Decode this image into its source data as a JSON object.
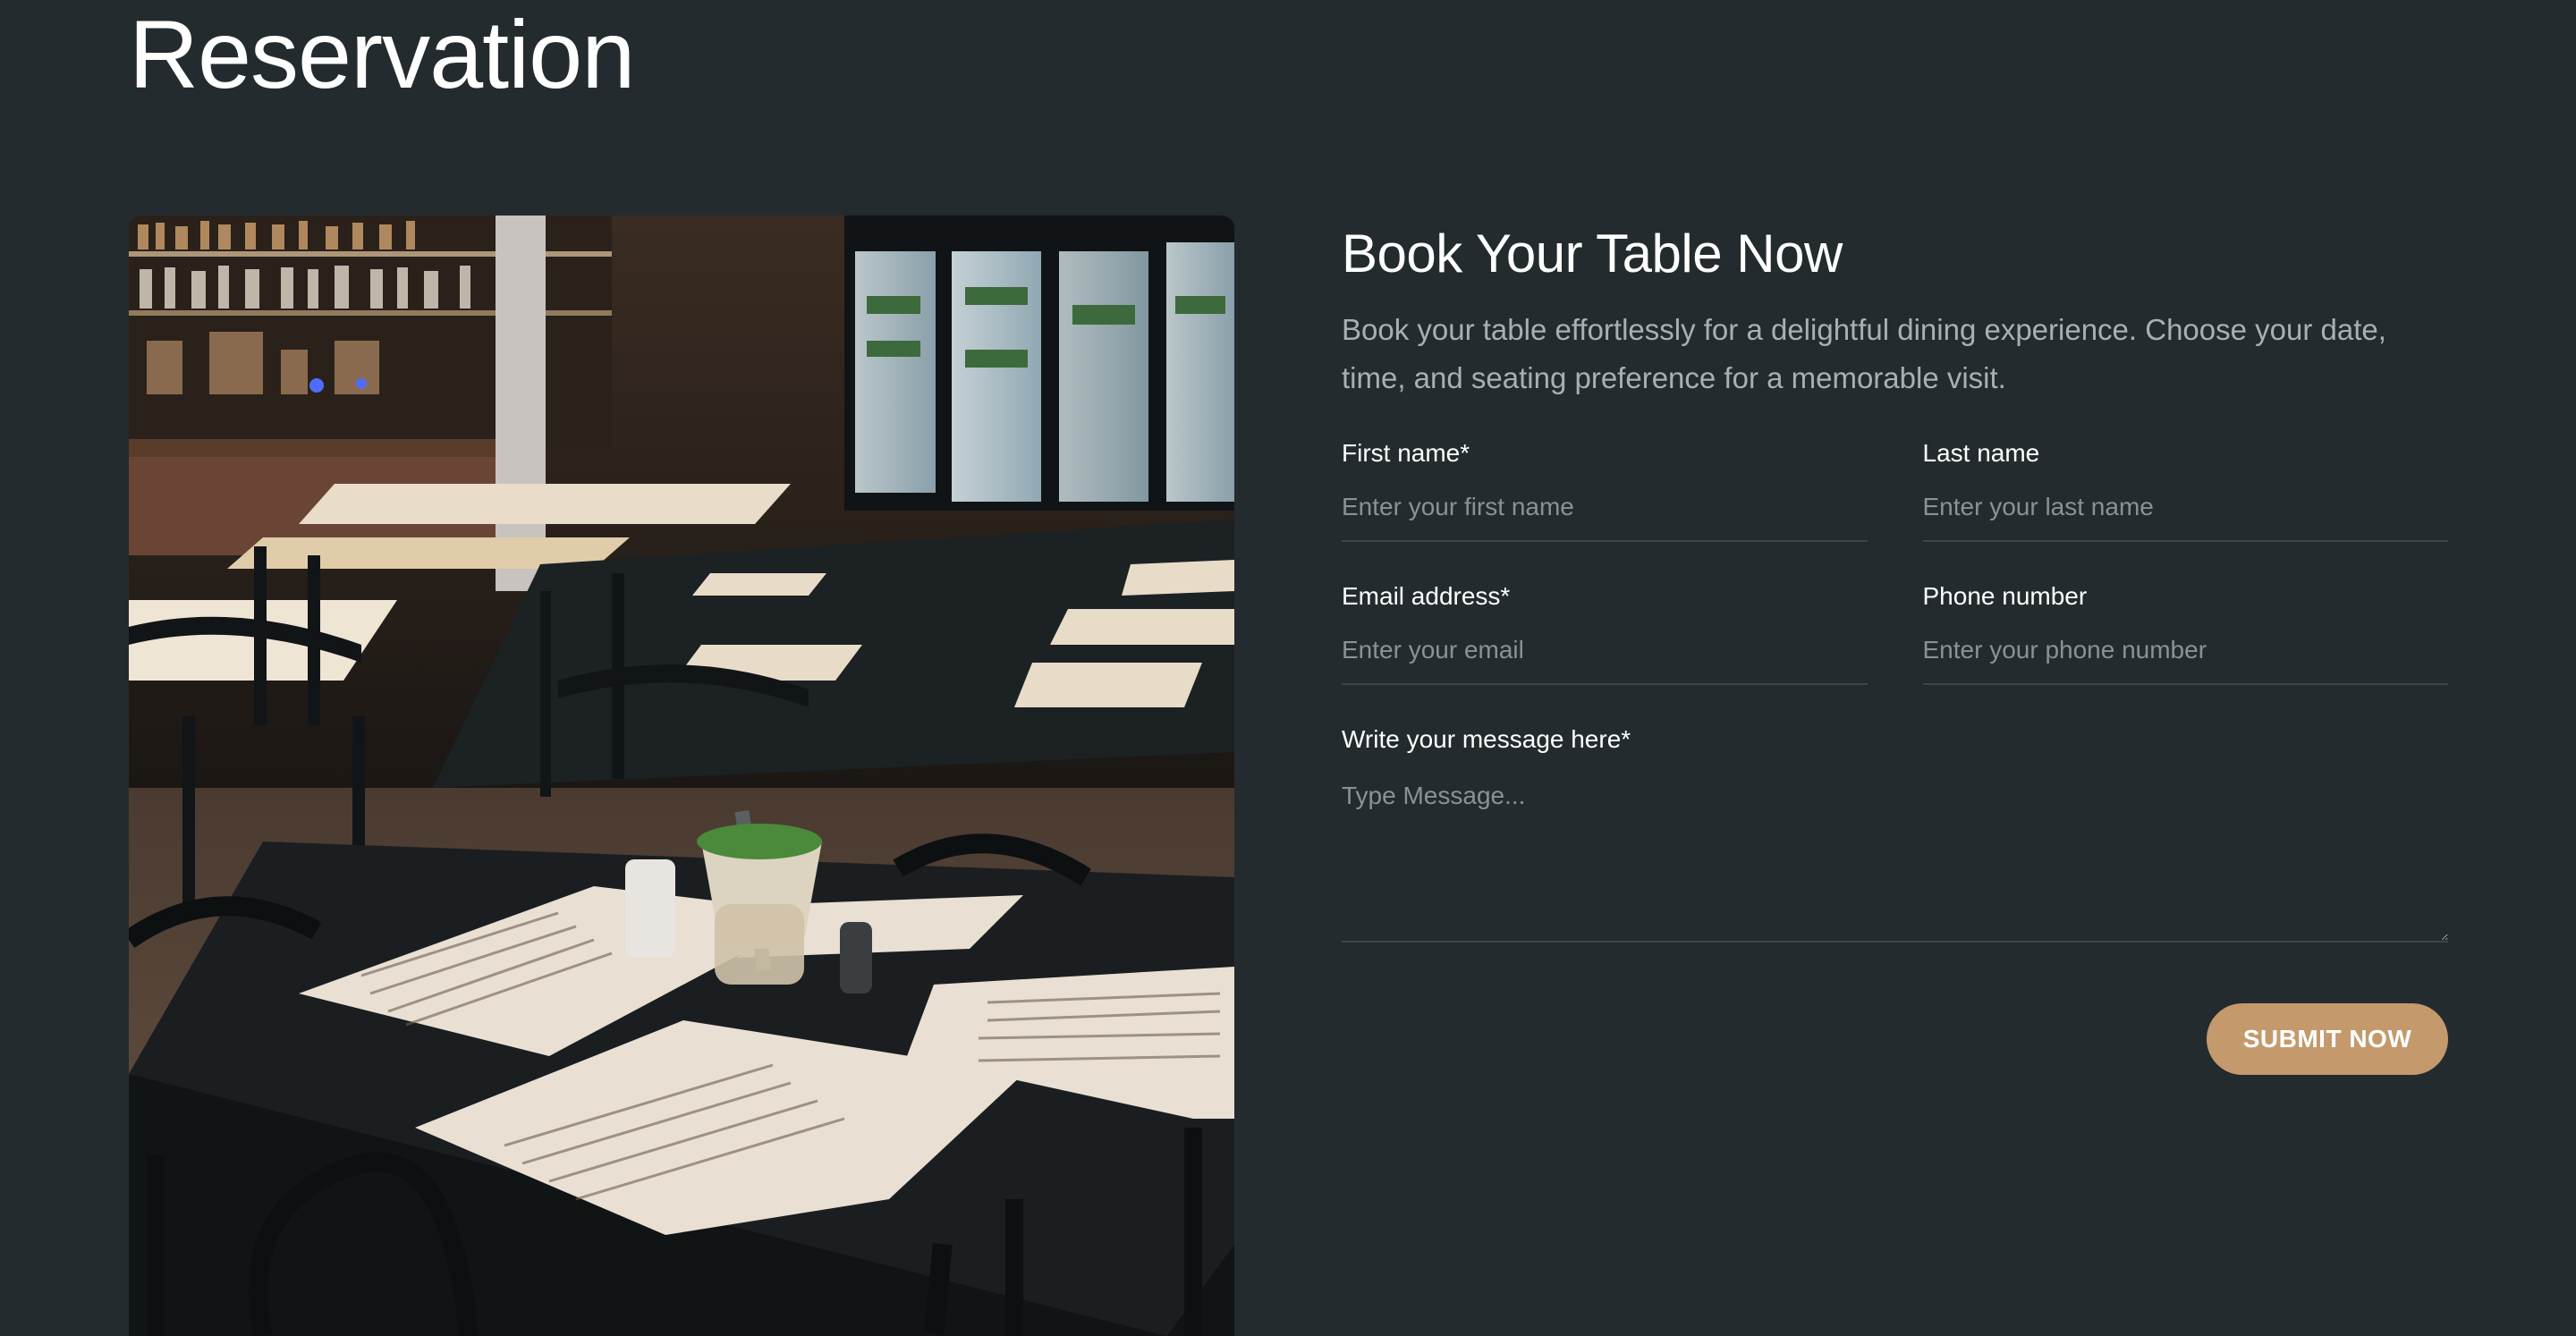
{
  "section": {
    "title": "Reservation"
  },
  "form": {
    "title": "Book Your Table Now",
    "description": "Book your table effortlessly for a delightful dining experience. Choose your date, time, and seating preference for a memorable visit.",
    "fields": {
      "first_name": {
        "label": "First name*",
        "placeholder": "Enter your first name",
        "value": ""
      },
      "last_name": {
        "label": "Last name",
        "placeholder": "Enter your last name",
        "value": ""
      },
      "email": {
        "label": "Email address*",
        "placeholder": "Enter your email",
        "value": ""
      },
      "phone": {
        "label": "Phone number",
        "placeholder": "Enter your phone number",
        "value": ""
      },
      "message": {
        "label": "Write your message here*",
        "placeholder": "Type Message...",
        "value": ""
      }
    },
    "submit_label": "SUBMIT NOW"
  },
  "colors": {
    "background": "#242b2e",
    "accent": "#c49a6c",
    "text_muted": "#a9afb2",
    "placeholder": "#8b9295",
    "field_border": "#3e4649"
  },
  "image": {
    "subject": "restaurant-interior-photo"
  }
}
